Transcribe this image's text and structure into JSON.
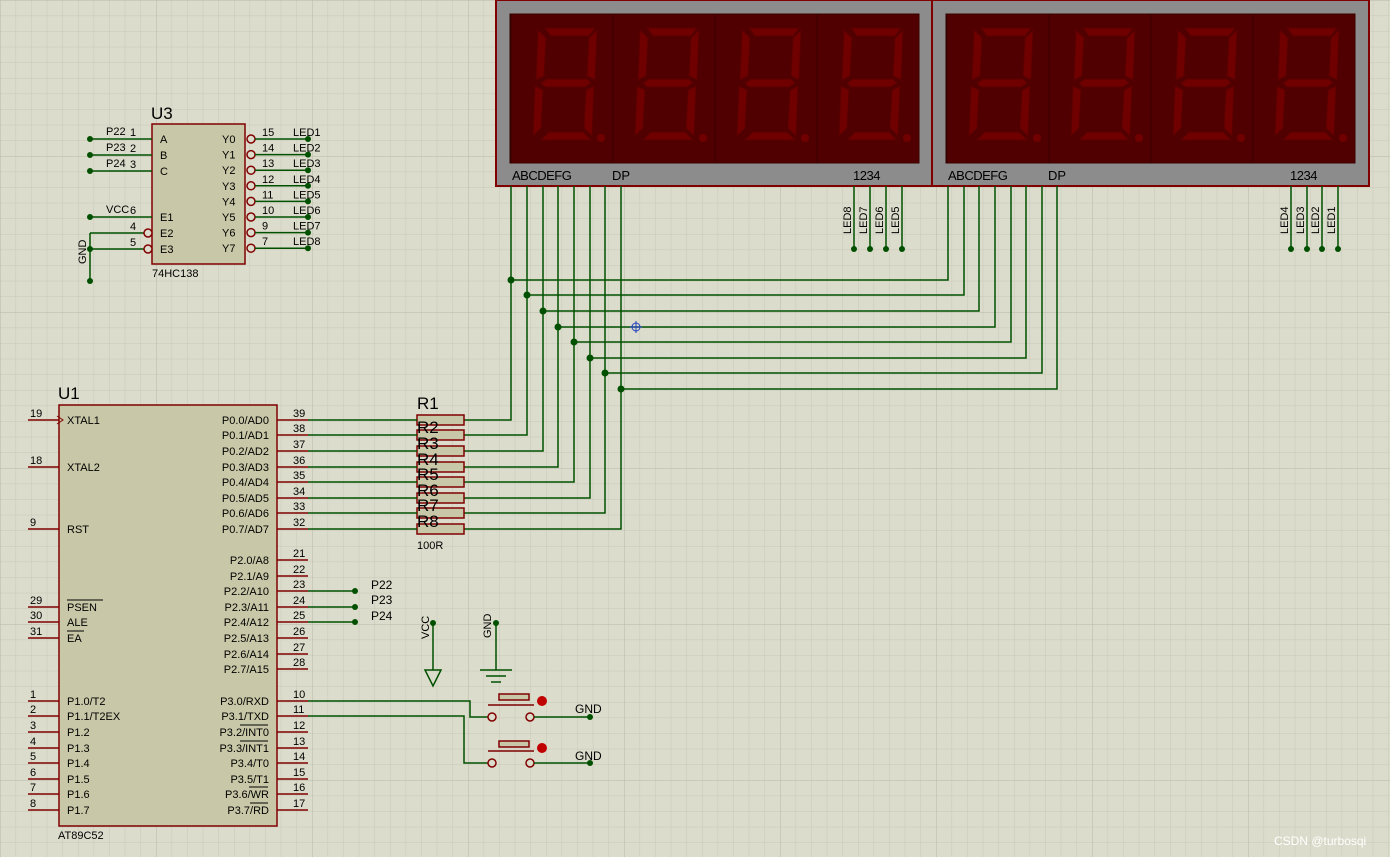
{
  "chips": {
    "u3": {
      "ref": "U3",
      "part": "74HC138",
      "left_pins": [
        {
          "name": "A",
          "num": "1",
          "net": "P22"
        },
        {
          "name": "B",
          "num": "2",
          "net": "P23"
        },
        {
          "name": "C",
          "num": "3",
          "net": "P24"
        },
        {
          "name": "E1",
          "num": "6",
          "net": "VCC"
        },
        {
          "name": "E2",
          "num": "4",
          "net": ""
        },
        {
          "name": "E3",
          "num": "5",
          "net": ""
        }
      ],
      "right_pins": [
        {
          "name": "Y0",
          "num": "15",
          "net": "LED1"
        },
        {
          "name": "Y1",
          "num": "14",
          "net": "LED2"
        },
        {
          "name": "Y2",
          "num": "13",
          "net": "LED3"
        },
        {
          "name": "Y3",
          "num": "12",
          "net": "LED4"
        },
        {
          "name": "Y4",
          "num": "11",
          "net": "LED5"
        },
        {
          "name": "Y5",
          "num": "10",
          "net": "LED6"
        },
        {
          "name": "Y6",
          "num": "9",
          "net": "LED7"
        },
        {
          "name": "Y7",
          "num": "7",
          "net": "LED8"
        }
      ],
      "gnd_label": "GND"
    },
    "u1": {
      "ref": "U1",
      "part": "AT89C52",
      "left_pins": [
        {
          "name": "XTAL1",
          "num": "19"
        },
        {
          "name": "XTAL2",
          "num": "18"
        },
        {
          "name": "RST",
          "num": "9"
        },
        {
          "name": "PSEN",
          "num": "29"
        },
        {
          "name": "ALE",
          "num": "30"
        },
        {
          "name": "EA",
          "num": "31"
        },
        {
          "name": "P1.0/T2",
          "num": "1"
        },
        {
          "name": "P1.1/T2EX",
          "num": "2"
        },
        {
          "name": "P1.2",
          "num": "3"
        },
        {
          "name": "P1.3",
          "num": "4"
        },
        {
          "name": "P1.4",
          "num": "5"
        },
        {
          "name": "P1.5",
          "num": "6"
        },
        {
          "name": "P1.6",
          "num": "7"
        },
        {
          "name": "P1.7",
          "num": "8"
        }
      ],
      "right_pins": [
        {
          "name": "P0.0/AD0",
          "num": "39"
        },
        {
          "name": "P0.1/AD1",
          "num": "38"
        },
        {
          "name": "P0.2/AD2",
          "num": "37"
        },
        {
          "name": "P0.3/AD3",
          "num": "36"
        },
        {
          "name": "P0.4/AD4",
          "num": "35"
        },
        {
          "name": "P0.5/AD5",
          "num": "34"
        },
        {
          "name": "P0.6/AD6",
          "num": "33"
        },
        {
          "name": "P0.7/AD7",
          "num": "32"
        },
        {
          "name": "P2.0/A8",
          "num": "21"
        },
        {
          "name": "P2.1/A9",
          "num": "22"
        },
        {
          "name": "P2.2/A10",
          "num": "23"
        },
        {
          "name": "P2.3/A11",
          "num": "24"
        },
        {
          "name": "P2.4/A12",
          "num": "25"
        },
        {
          "name": "P2.5/A13",
          "num": "26"
        },
        {
          "name": "P2.6/A14",
          "num": "27"
        },
        {
          "name": "P2.7/A15",
          "num": "28"
        },
        {
          "name": "P3.0/RXD",
          "num": "10"
        },
        {
          "name": "P3.1/TXD",
          "num": "11"
        },
        {
          "name": "P3.2/INT0",
          "num": "12"
        },
        {
          "name": "P3.3/INT1",
          "num": "13"
        },
        {
          "name": "P3.4/T0",
          "num": "14"
        },
        {
          "name": "P3.5/T1",
          "num": "15"
        },
        {
          "name": "P3.6/WR",
          "num": "16"
        },
        {
          "name": "P3.7/RD",
          "num": "17"
        }
      ],
      "p2_nets": [
        "P22",
        "P23",
        "P24"
      ]
    }
  },
  "resistors": {
    "labels": [
      "R1",
      "R2",
      "R3",
      "R4",
      "R5",
      "R6",
      "R7",
      "R8"
    ],
    "value": "100R"
  },
  "displays": [
    {
      "seg_label": "ABCDEFG",
      "dp_label": "DP",
      "digit_label": "1234",
      "led_nets": [
        "LED8",
        "LED7",
        "LED6",
        "LED5"
      ]
    },
    {
      "seg_label": "ABCDEFG",
      "dp_label": "DP",
      "digit_label": "1234",
      "led_nets": [
        "LED4",
        "LED3",
        "LED2",
        "LED1"
      ]
    }
  ],
  "power": {
    "vcc": "VCC",
    "gnd": "GND",
    "btn_gnd": [
      "GND",
      "GND"
    ]
  },
  "watermark": "CSDN @turbosqi",
  "colors": {
    "background": "#dcdccc",
    "grid": "#c8c8b8",
    "wire": "#005000",
    "component_border": "#800000",
    "chip_fill": "#c8c8a8",
    "display_body": "#8c8c8c",
    "digit_bg": "#500000",
    "segment_off": "#700000"
  }
}
